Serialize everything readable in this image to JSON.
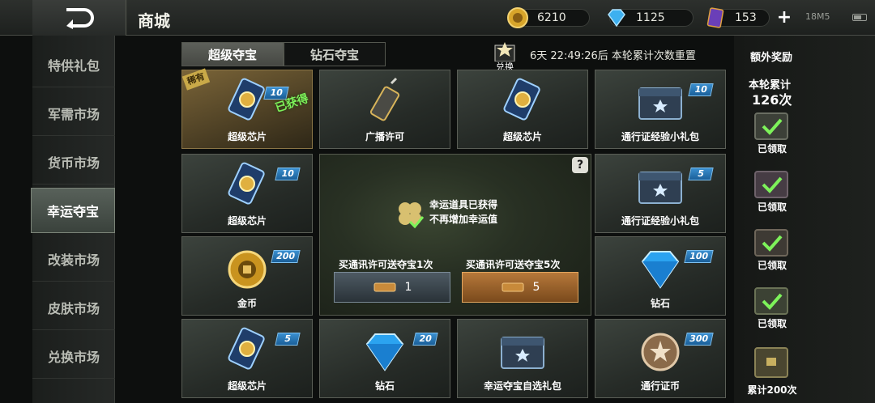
{
  "header": {
    "title": "商城",
    "currencies": {
      "gold": "6210",
      "diamond": "1125",
      "card": "153"
    },
    "status": "18M5"
  },
  "sidebar": {
    "items": [
      {
        "label": "特供礼包"
      },
      {
        "label": "军需市场"
      },
      {
        "label": "货币市场"
      },
      {
        "label": "幸运夺宝"
      },
      {
        "label": "改装市场"
      },
      {
        "label": "皮肤市场"
      },
      {
        "label": "兑换市场"
      }
    ]
  },
  "tabs": [
    "超级夺宝",
    "钻石夺宝"
  ],
  "exchange_label": "兑换",
  "timer": "6天 22:49:26后 本轮累计次数重置",
  "grid": [
    {
      "name": "超级芯片",
      "badge": "10",
      "ribbon": "稀有",
      "obtained": "已获得"
    },
    {
      "name": "广播许可"
    },
    {
      "name": "超级芯片"
    },
    {
      "name": "通行证经验小礼包",
      "badge": "10"
    },
    {
      "name": "超级芯片",
      "badge": "10"
    },
    {
      "name": "通行证经验小礼包",
      "badge": "5"
    },
    {
      "name": "金币",
      "badge": "200"
    },
    {
      "name": "钻石",
      "badge": "100"
    },
    {
      "name": "超级芯片",
      "badge": "5"
    },
    {
      "name": "钻石",
      "badge": "20"
    },
    {
      "name": "幸运夺宝自选礼包"
    },
    {
      "name": "通行证币",
      "badge": "300"
    }
  ],
  "center": {
    "luck_line1": "幸运道具已获得",
    "luck_line2": "不再增加幸运值",
    "buy1_label": "买通讯许可送夺宝1次",
    "buy1_value": "1",
    "buy5_label": "买通讯许可送夺宝5次",
    "buy5_value": "5",
    "help": "?"
  },
  "rewards": {
    "title": "额外奖励",
    "sub": "本轮累计",
    "count": "126次",
    "items": [
      {
        "label": "已领取"
      },
      {
        "label": "已领取"
      },
      {
        "label": "已领取"
      },
      {
        "label": "已领取"
      },
      {
        "label": "累计200次"
      }
    ]
  },
  "colors": {
    "badge_blue": "#2a7fc0",
    "obtained_green": "#7df25a",
    "active_tab": "#5d605a"
  }
}
